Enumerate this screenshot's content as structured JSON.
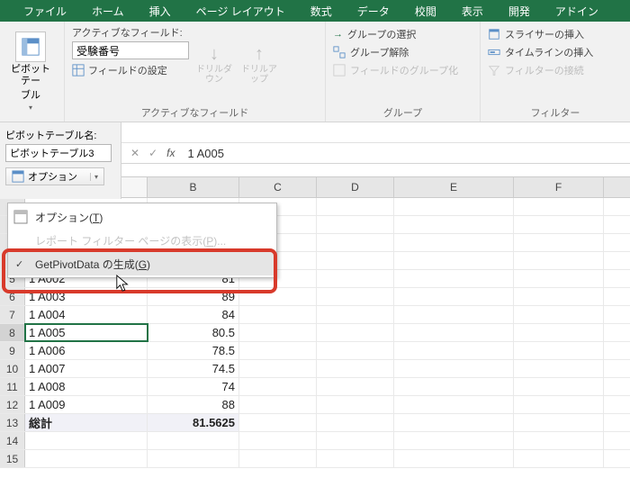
{
  "ribbon": {
    "tabs": [
      "ファイル",
      "ホーム",
      "挿入",
      "ページ レイアウト",
      "数式",
      "データ",
      "校閲",
      "表示",
      "開発",
      "アドイン"
    ],
    "group1": {
      "button_l1": "ピボットテー",
      "button_l2": "ブル",
      "label": ""
    },
    "group2": {
      "title": "アクティブなフィールド:",
      "field_value": "受験番号",
      "setting": "フィールドの設定",
      "drill_down": "ドリルダウン",
      "drill_up": "ドリルアップ",
      "label": "アクティブなフィールド"
    },
    "group3": {
      "items": [
        "グループの選択",
        "グループ解除",
        "フィールドのグループ化"
      ],
      "label": "グループ"
    },
    "group4": {
      "items": [
        "スライサーの挿入",
        "タイムラインの挿入",
        "フィルターの接続"
      ],
      "label": "フィルター"
    }
  },
  "pivot_panel": {
    "name_label": "ピボットテーブル名:",
    "name_value": "ピボットテーブル3",
    "option_button": "オプション"
  },
  "formula_bar": {
    "value": "1 A005"
  },
  "grid": {
    "columns": [
      "B",
      "C",
      "D",
      "E",
      "F"
    ],
    "rows": [
      {
        "n": 5,
        "a": "1 A002",
        "b": "81"
      },
      {
        "n": 6,
        "a": "1 A003",
        "b": "89"
      },
      {
        "n": 7,
        "a": "1 A004",
        "b": "84"
      },
      {
        "n": 8,
        "a": "1 A005",
        "b": "80.5",
        "active": true
      },
      {
        "n": 9,
        "a": "1 A006",
        "b": "78.5"
      },
      {
        "n": 10,
        "a": "1 A007",
        "b": "74.5"
      },
      {
        "n": 11,
        "a": "1 A008",
        "b": "74"
      },
      {
        "n": 12,
        "a": "1 A009",
        "b": "88"
      },
      {
        "n": 13,
        "a": "総計",
        "b": "81.5625",
        "total": true
      },
      {
        "n": 14,
        "a": "",
        "b": ""
      },
      {
        "n": 15,
        "a": "",
        "b": ""
      }
    ],
    "hidden_row_numbers": [
      "",
      "",
      "",
      ""
    ]
  },
  "menu": {
    "items": [
      {
        "label": "オプション",
        "mn": "T",
        "icon": true
      },
      {
        "label": "レポート フィルター ページの表示",
        "mn": "P",
        "disabled": true
      },
      {
        "label": "GetPivotData の生成",
        "mn": "G",
        "checked": true,
        "highlight": true
      }
    ]
  }
}
